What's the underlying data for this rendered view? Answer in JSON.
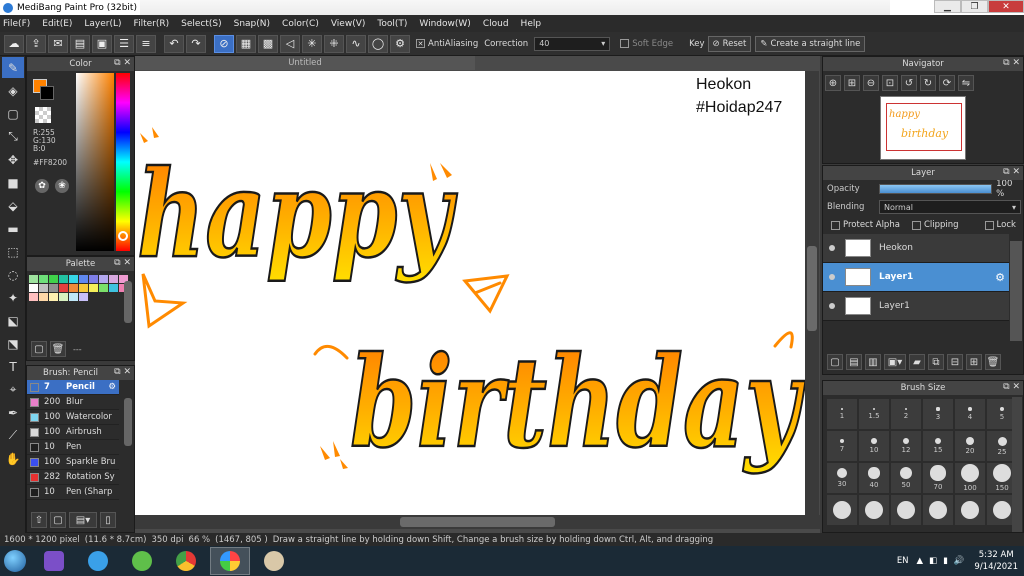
{
  "window": {
    "title": "MediBang Paint Pro (32bit)"
  },
  "menu": [
    "File(F)",
    "Edit(E)",
    "Layer(L)",
    "Filter(R)",
    "Select(S)",
    "Snap(N)",
    "Color(C)",
    "View(V)",
    "Tool(T)",
    "Window(W)",
    "Cloud",
    "Help"
  ],
  "toolbar": {
    "antialiasing_label": "AntiAliasing",
    "correction_label": "Correction",
    "correction_value": "40",
    "soft_edge_label": "Soft Edge",
    "key_label": "Key",
    "reset_label": "Reset",
    "straight_line_label": "Create a straight line"
  },
  "color_panel": {
    "title": "Color",
    "rgb": {
      "r": "R:255",
      "g": "G:130",
      "b": "B:0"
    },
    "hex": "#FF8200",
    "fg_color": "#ff8200",
    "bg_color": "#000000"
  },
  "palette_panel": {
    "title": "Palette",
    "colors": [
      "#9fe39f",
      "#6ee07a",
      "#3fd14a",
      "#22c2a2",
      "#36d6e6",
      "#5f88f0",
      "#7f7fe8",
      "#b3a8f0",
      "#d8a8e0",
      "#ef9bd1",
      "#ffffff",
      "#c0c0c0",
      "#909090",
      "#e33e3e",
      "#f08a3a",
      "#f5c93a",
      "#f5ef5a",
      "#7be06a",
      "#3fc3e0",
      "#ef7fb2",
      "#ffc0c0",
      "#ffd8a8",
      "#fff0b0",
      "#d8f0c0",
      "#c0e8f8",
      "#c8c0f8"
    ],
    "footer_text": "---"
  },
  "brush_panel": {
    "title": "Brush: Pencil",
    "items": [
      {
        "size": "7",
        "name": "Pencil",
        "color": "#3b6fc4"
      },
      {
        "size": "200",
        "name": "Blur",
        "color": "#e87fc9"
      },
      {
        "size": "100",
        "name": "Watercolor",
        "color": "#7fd6f0"
      },
      {
        "size": "100",
        "name": "Airbrush",
        "color": "#d8d8d8"
      },
      {
        "size": "10",
        "name": "Pen",
        "color": "#1e1e1e"
      },
      {
        "size": "100",
        "name": "Sparkle Bru",
        "color": "#3b4ff0"
      },
      {
        "size": "282",
        "name": "Rotation Sy",
        "color": "#e83030"
      },
      {
        "size": "10",
        "name": "Pen (Sharp",
        "color": "#1e1e1e"
      }
    ]
  },
  "canvas": {
    "tab_title": "Untitled",
    "watermark_line1": "Heokon",
    "watermark_line2": "#Hoidap247",
    "art_word1": "happy",
    "art_word2": "birthday"
  },
  "navigator": {
    "title": "Navigator"
  },
  "layer_panel": {
    "title": "Layer",
    "opacity_label": "Opacity",
    "opacity_value": "100 %",
    "opacity_fraction": 1.0,
    "blending_label": "Blending",
    "blending_value": "Normal",
    "protect_alpha_label": "Protect Alpha",
    "clipping_label": "Clipping",
    "lock_label": "Lock",
    "layers": [
      {
        "name": "Heokon",
        "selected": false
      },
      {
        "name": "Layer1",
        "selected": true
      },
      {
        "name": "Layer1",
        "selected": false
      }
    ]
  },
  "brush_size_panel": {
    "title": "Brush Size",
    "sizes": [
      "1",
      "1.5",
      "2",
      "3",
      "4",
      "5",
      "7",
      "10",
      "12",
      "15",
      "20",
      "25",
      "30",
      "40",
      "50",
      "70",
      "100",
      "150",
      "",
      "",
      "",
      "",
      "",
      ""
    ]
  },
  "status": {
    "image_size": "1600 * 1200 pixel",
    "physical_size": "(11.6 * 8.7cm)",
    "dpi": "350 dpi",
    "zoom": "66 %",
    "coords": "(1467, 805 )",
    "hint": "Draw a straight line by holding down Shift, Change a brush size by holding down Ctrl, Alt, and dragging"
  },
  "taskbar": {
    "lang": "EN",
    "time": "5:32 AM",
    "date": "9/14/2021"
  }
}
